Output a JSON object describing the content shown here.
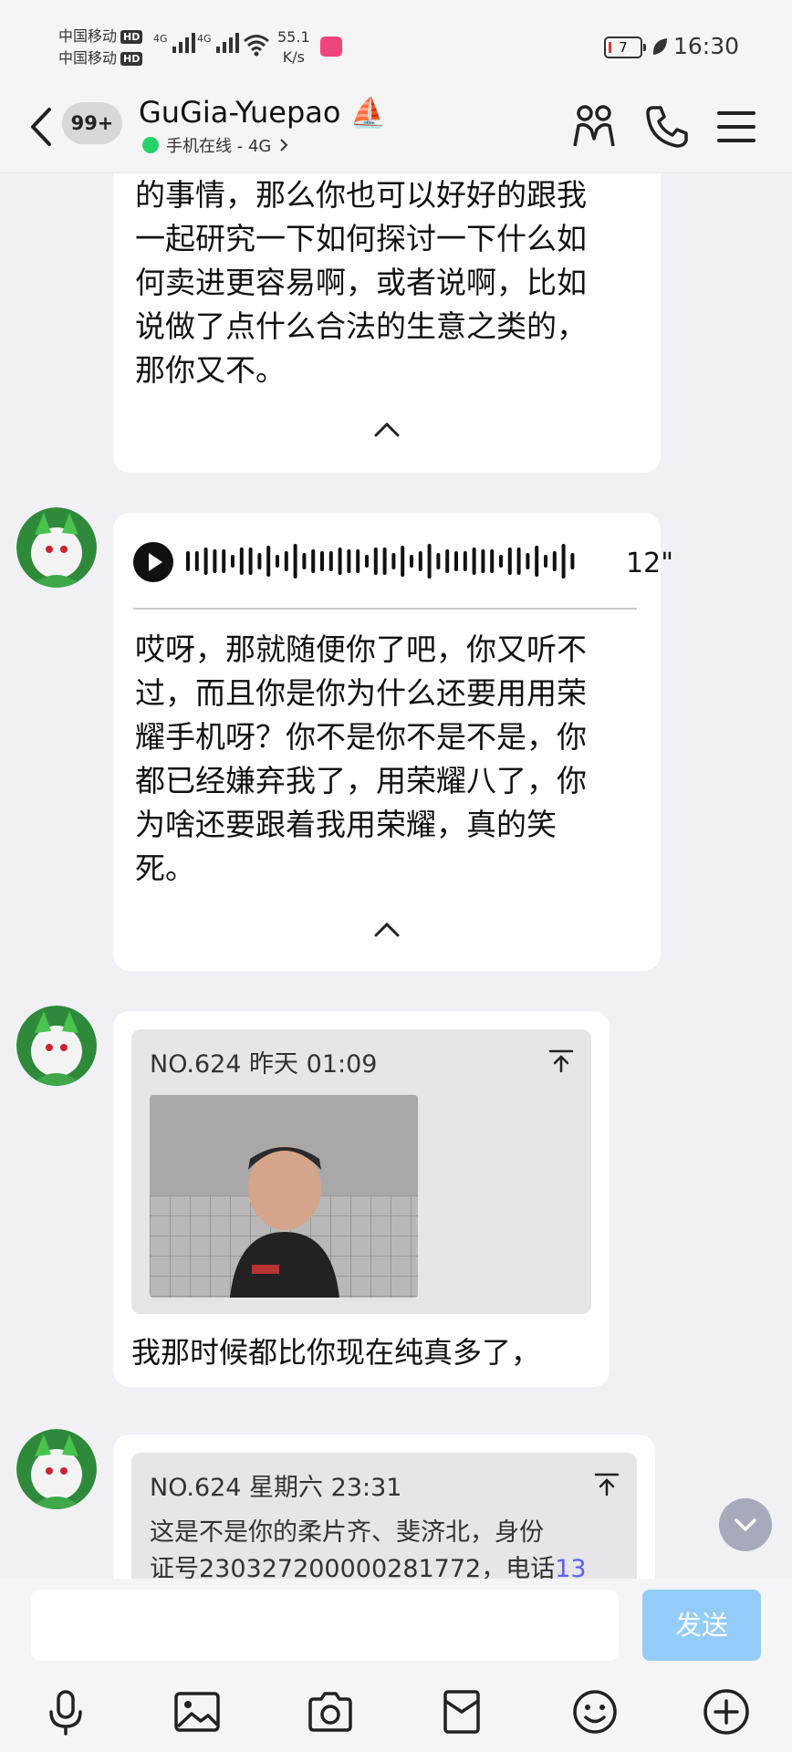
{
  "status_bar": {
    "carrier_1": "中国移动",
    "carrier_2": "中国移动",
    "hd": "HD",
    "network_tag": "4G",
    "speed_value": "55.1",
    "speed_unit": "K/s",
    "battery": "7",
    "time": "16:30"
  },
  "header": {
    "unread_count": "99+",
    "contact_name": "GuGia-Yuepao ⛵",
    "online_status": "手机在线 - 4G"
  },
  "messages": [
    {
      "text": "的事情，那么你也可以好好的跟我\n一起研究一下如何探讨一下什么如\n何卖进更容易啊，或者说啊，比如\n说做了点什么合法的生意之类的，\n那你又不。"
    },
    {
      "duration": "12\"",
      "text": "哎呀，那就随便你了吧，你又听不\n过，而且你是你为什么还要用用荣\n耀手机呀？你不是你不是不是，你\n都已经嫌弃我了，用荣耀八了，你\n为啥还要跟着我用荣耀，真的笑\n死。"
    },
    {
      "quote_header": "NO.624 昨天 01:09",
      "text": "我那时候都比你现在纯真多了，"
    },
    {
      "quote_header": "NO.624 星期六 23:31",
      "quote_text": "这是不是你的柔片齐、斐济北，身份",
      "quote_text_2": "证号2303272000002817​72，电话",
      "quote_text_num": "13"
    }
  ],
  "input": {
    "value": "",
    "send_label": "发送"
  },
  "toolbar": [
    "microphone-icon",
    "image-icon",
    "camera-icon",
    "red-packet-icon",
    "emoji-icon",
    "plus-icon"
  ],
  "colors": {
    "background": "#f1f1f5",
    "online_dot": "#27d26a",
    "send_button": "#93cdf7",
    "link_number": "#5b5ff0"
  }
}
